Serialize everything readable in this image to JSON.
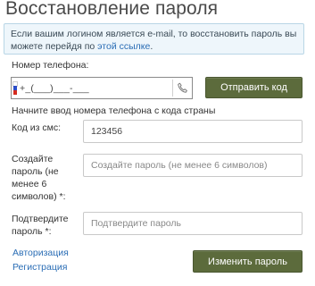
{
  "page": {
    "title": "Восстановление пароля"
  },
  "notice": {
    "text_before": "Если вашим логином является e-mail, то восстановить пароль вы можете перейдя по ",
    "link": "этой ссылке",
    "text_after": "."
  },
  "phone": {
    "label": "Номер телефона:",
    "mask": "+_(___)___-___",
    "flag_colors": [
      "#ffffff",
      "#2b4cc7",
      "#d52b1e"
    ],
    "icon": "phone-icon",
    "send_button": "Отправить код",
    "hint": "Начните ввод номера телефона с кода страны"
  },
  "sms": {
    "label": "Код из смс:",
    "value": "123456"
  },
  "new_password": {
    "label_lines": [
      "Создайте",
      "пароль (не",
      "менее 6",
      "символов) *:"
    ],
    "placeholder": "Создайте пароль (не менее 6 символов)"
  },
  "confirm_password": {
    "label_lines": [
      "Подтвердите",
      "пароль *:"
    ],
    "placeholder": "Подтвердите пароль"
  },
  "footer": {
    "login_link": "Авторизация",
    "register_link": "Регистрация",
    "submit_button": "Изменить пароль"
  },
  "colors": {
    "button_bg": "#5c6b3c",
    "link": "#2a6db5",
    "notice_bg": "#eef6fb"
  }
}
